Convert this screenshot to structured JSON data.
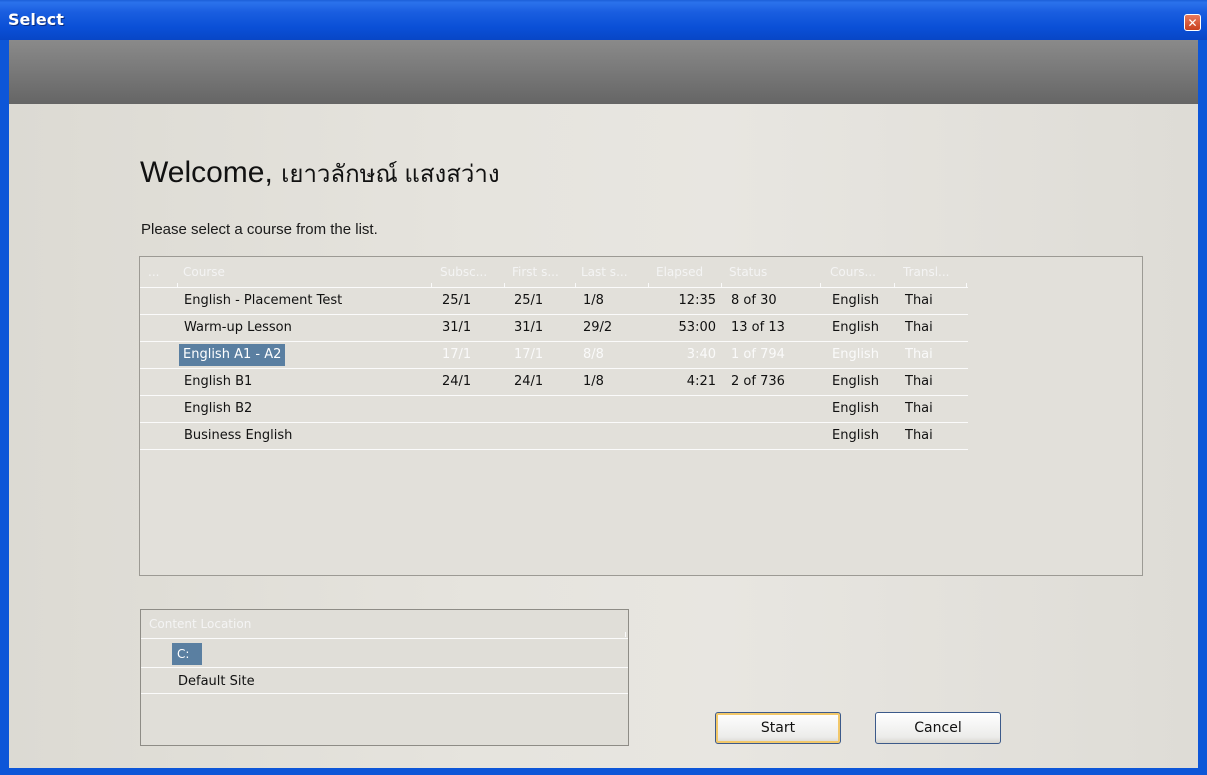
{
  "window": {
    "title": "Select",
    "close_glyph": "✕"
  },
  "welcome": {
    "greeting": "Welcome,",
    "name": "เยาวลักษณ์ แสงสว่าง"
  },
  "prompt": "Please select a course from the list.",
  "course_table": {
    "headers": [
      "...",
      "Course",
      "Subsc...",
      "First s...",
      "Last s...",
      "Elapsed",
      "Status",
      "Cours...",
      "Transl..."
    ],
    "rows": [
      {
        "course": "English - Placement Test",
        "subscribed": "25/1",
        "first": "25/1",
        "last": "1/8",
        "elapsed": "12:35",
        "status": "8 of 30",
        "language": "English",
        "translation": "Thai"
      },
      {
        "course": "Warm-up Lesson",
        "subscribed": "31/1",
        "first": "31/1",
        "last": "29/2",
        "elapsed": "53:00",
        "status": "13 of 13",
        "language": "English",
        "translation": "Thai"
      },
      {
        "course": "English A1 - A2",
        "subscribed": "17/1",
        "first": "17/1",
        "last": "8/8",
        "elapsed": "3:40",
        "status": "1 of 794",
        "language": "English",
        "translation": "Thai",
        "selected": true
      },
      {
        "course": "English B1",
        "subscribed": "24/1",
        "first": "24/1",
        "last": "1/8",
        "elapsed": "4:21",
        "status": "2 of 736",
        "language": "English",
        "translation": "Thai"
      },
      {
        "course": "English B2",
        "subscribed": "",
        "first": "",
        "last": "",
        "elapsed": "",
        "status": "",
        "language": "English",
        "translation": "Thai"
      },
      {
        "course": "Business English",
        "subscribed": "",
        "first": "",
        "last": "",
        "elapsed": "",
        "status": "",
        "language": "English",
        "translation": "Thai"
      }
    ]
  },
  "content_location": {
    "header": "Content Location",
    "items": [
      "C:",
      "Default Site"
    ],
    "selected": "C:"
  },
  "buttons": {
    "start": "Start",
    "cancel": "Cancel"
  },
  "colors": {
    "selection": "#5a7fa1",
    "title_bar": "#0a4fd6",
    "header_band": "#7a7a7a"
  },
  "icons": {
    "close": "close-icon"
  }
}
